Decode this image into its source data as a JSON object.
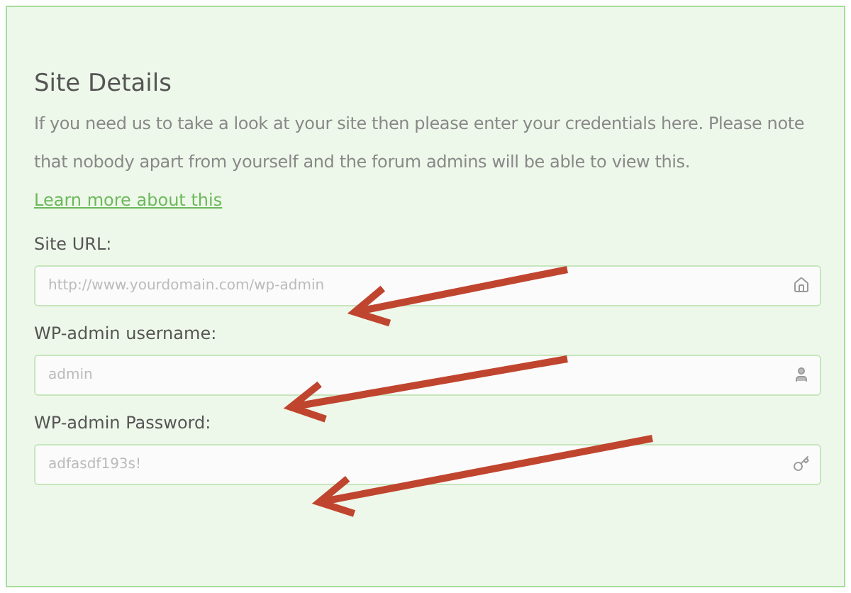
{
  "panel": {
    "title": "Site Details",
    "description": "If you need us to take a look at your site then please enter your credentials here. Please note that nobody apart from yourself and the forum admins will be able to view this.",
    "link": "Learn more about this",
    "fields": [
      {
        "label": "Site URL:",
        "placeholder": "http://www.yourdomain.com/wp-admin",
        "kind": "site"
      },
      {
        "label": "WP-admin username:",
        "placeholder": "admin",
        "kind": "user"
      },
      {
        "label": "WP-admin Password:",
        "placeholder": "adfasdf193s!",
        "kind": "key"
      }
    ]
  }
}
